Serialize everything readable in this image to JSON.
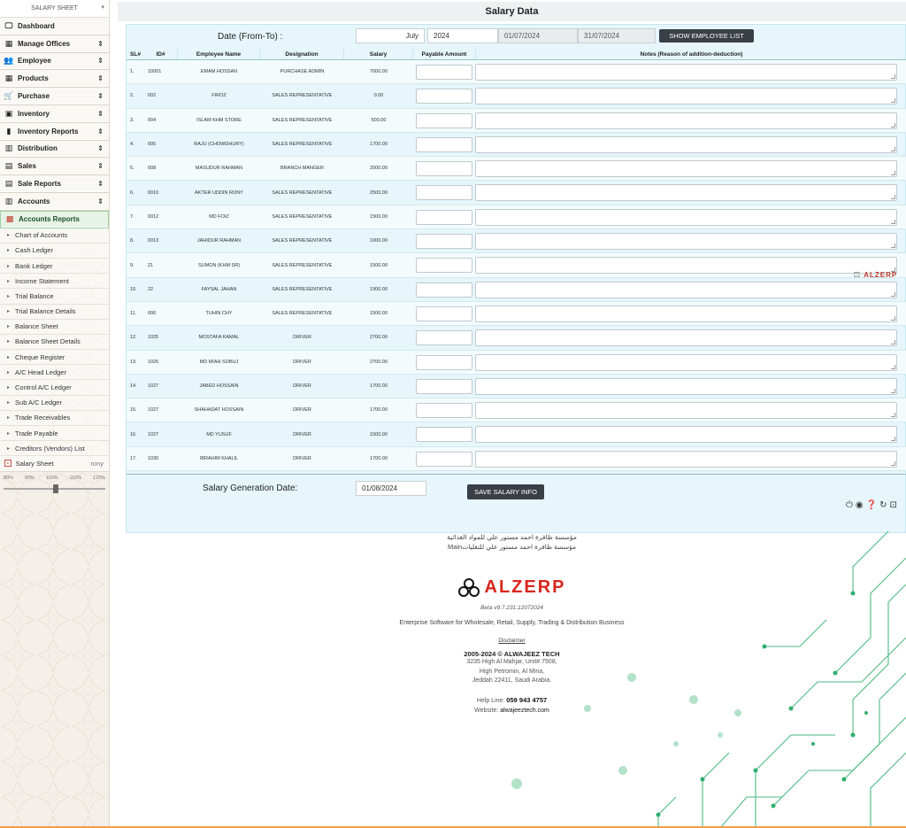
{
  "sidebar": {
    "header": "SALARY SHEET",
    "menu": [
      {
        "label": "Dashboard",
        "icon": "monitor-icon",
        "arrow": ""
      },
      {
        "label": "Manage Offices",
        "icon": "building-icon",
        "arrow": "⇕"
      },
      {
        "label": "Employee",
        "icon": "users-icon",
        "arrow": "⇕"
      },
      {
        "label": "Products",
        "icon": "grid-icon",
        "arrow": "⇕"
      },
      {
        "label": "Purchase",
        "icon": "cart-icon",
        "arrow": "⇕"
      },
      {
        "label": "Inventory",
        "icon": "box-icon",
        "arrow": "⇕"
      },
      {
        "label": "Inventory Reports",
        "icon": "bar-chart-icon",
        "arrow": "⇕"
      },
      {
        "label": "Distribution",
        "icon": "map-icon",
        "arrow": "⇕"
      },
      {
        "label": "Sales",
        "icon": "register-icon",
        "arrow": "⇕"
      },
      {
        "label": "Sale Reports",
        "icon": "report-icon",
        "arrow": "⇕"
      },
      {
        "label": "Accounts",
        "icon": "bank-icon",
        "arrow": "⇕"
      },
      {
        "label": "Accounts Reports",
        "icon": "chart-icon",
        "arrow": ""
      }
    ],
    "submenu": [
      "Chart of Accounts",
      "Cash Ledger",
      "Bank Ledger",
      "Income Statement",
      "Trial Balance",
      "Trial Balance Details",
      "Balance Sheet",
      "Balance Sheet Details",
      "Cheque Register",
      "A/C Head Ledger",
      "Control A/C Ledger",
      "Sub A/C Ledger",
      "Trade Receivables",
      "Trade Payable",
      "Creditors (Vendors) List"
    ],
    "salary_sheet": {
      "label": "Salary Sheet",
      "user": "rony"
    },
    "zoom_levels": [
      "80%",
      "90%",
      "100%",
      "110%",
      "120%"
    ]
  },
  "main": {
    "title": "Salary Data",
    "date_label": "Date (From-To) :",
    "month": "July",
    "year": "2024",
    "from_date": "01/07/2024",
    "to_date": "31/07/2024",
    "show_button": "SHOW EMPLOYEE LIST",
    "columns": [
      "SL#",
      "ID#",
      "Employee Name",
      "Designation",
      "Salary",
      "Payable Amount",
      "Notes (Reason of addition-deduction)"
    ],
    "rows": [
      [
        "1.",
        "10001",
        "EMAM HOSSAN",
        "PURCHASE ADMIN",
        "7000.00"
      ],
      [
        "2.",
        "002",
        "FIROZ",
        "SALES REPRESENTATIVE",
        "0.00"
      ],
      [
        "3.",
        "004",
        "ISLAM KHM STORE",
        "SALES REPRESENTATIVE",
        "500.00"
      ],
      [
        "4.",
        "005",
        "RAJU (CHOWDHURY)",
        "SALES REPRESENTATIVE",
        "1700.00"
      ],
      [
        "5.",
        "008",
        "MASUDUR RAHMAN",
        "BRANCH MANGER",
        "2000.00"
      ],
      [
        "6.",
        "0010",
        "AKTER UDDIN RONY",
        "SALES REPRESENTATIVE",
        "2500.00"
      ],
      [
        "7.",
        "0012",
        "MD FOIZ",
        "SALES REPRESENTATIVE",
        "1500.00"
      ],
      [
        "8.",
        "0013",
        "JAHIDUR RAHMAN",
        "SALES REPRESENTATIVE",
        "1000.00"
      ],
      [
        "9.",
        "21",
        "SUMON (KHM SR)",
        "SALES REPRESENTATIVE",
        "1500.00"
      ],
      [
        "10.",
        "22",
        "FAYSAL JAHAN",
        "SALES REPRESENTATIVE",
        "1900.00"
      ],
      [
        "11.",
        "006",
        "TUHIN CHY",
        "SALES REPRESENTATIVE",
        "1500.00"
      ],
      [
        "12.",
        "1025",
        "MOSTAFA KAMAL",
        "DRIVER",
        "2700.00"
      ],
      [
        "13.",
        "1026",
        "MD MIAH SOBUJ",
        "DRIVER",
        "2700.00"
      ],
      [
        "14.",
        "1027",
        "JABED HOSSAIN",
        "DRIVER",
        "1700.00"
      ],
      [
        "15.",
        "1027",
        "SHAHADAT HOSSAIN",
        "DRIVER",
        "1700.00"
      ],
      [
        "16.",
        "1027",
        "MD YUSUF",
        "DRIVER",
        "1500.00"
      ],
      [
        "17.",
        "1030",
        "IBRAHIM KHALIL",
        "DRIVER",
        "1700.00"
      ]
    ],
    "gen_label": "Salary Generation Date:",
    "gen_date": "01/08/2024",
    "save_button": "SAVE SALARY INFO",
    "watermark": "ALZERP"
  },
  "footer": {
    "arabic_line1": "مؤسسة ظافرة احمد مستور علي للمواد الغذائية",
    "arabic_line2": "Mainمؤسسة ظافرة احمد مستور علي للتقليات",
    "logo_text": "ALZERP",
    "beta": "Beta v9.7.231.12072024",
    "tagline": "Enterprise Software for Wholesale, Retail, Supply, Trading & Distribution Business",
    "disclaimer": "Disclaimer",
    "copyright": "2005-2024 © ALWAJEEZ TECH",
    "address1": "3235 High Al Mahjar, Unit# 7508,",
    "address2": "High Petromin, Al Mina,",
    "address3": "Jeddah 22411, Saudi Arabia.",
    "help_label": "Help Line:",
    "help_number": "059 943 4757",
    "web_label": "Website:",
    "web_value": "alwajeeztech.com"
  },
  "colors": {
    "accent": "#d7261e",
    "panel": "#e6f6fb",
    "circuit": "#2fae6e",
    "button": "#3a3f45"
  }
}
